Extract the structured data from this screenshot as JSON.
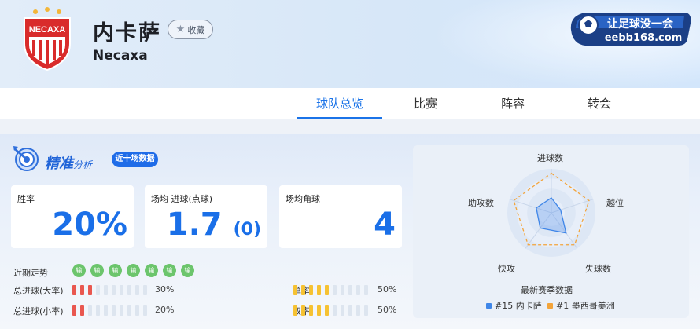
{
  "team": {
    "name_cn": "内卡萨",
    "name_en": "Necaxa",
    "crest_text": "NECAXA"
  },
  "favorite_label": "收藏",
  "site_logo": {
    "text_top": "让足球没一会",
    "text_bottom": "eebb168.com"
  },
  "tabs": [
    {
      "label": "球队总览",
      "active": true
    },
    {
      "label": "比赛",
      "active": false
    },
    {
      "label": "阵容",
      "active": false
    },
    {
      "label": "转会",
      "active": false
    }
  ],
  "analysis": {
    "title_main": "精准",
    "title_sub": "分析",
    "badge": "近十场数据",
    "cards": [
      {
        "label": "胜率",
        "value": "20%"
      },
      {
        "label": "场均 进球(点球)",
        "value": "1.7",
        "extra": "(0)"
      },
      {
        "label": "场均角球",
        "value": "4"
      }
    ],
    "recent_form": {
      "label": "近期走势",
      "results": [
        "输",
        "输",
        "输",
        "输",
        "输",
        "输",
        "输"
      ],
      "color": "#6cc56c"
    },
    "bars": [
      {
        "label": "总进球(大率)",
        "value": 30,
        "text": "30%",
        "color": "#e9574f"
      },
      {
        "label": "总进球(小率)",
        "value": 20,
        "text": "20%",
        "color": "#e9574f"
      },
      {
        "label": "单率",
        "value": 50,
        "text": "50%",
        "color": "#f6c232"
      },
      {
        "label": "双率",
        "value": 50,
        "text": "50%",
        "color": "#f6c232"
      }
    ]
  },
  "radar": {
    "axes": [
      "进球数",
      "越位",
      "失球数",
      "快攻",
      "助攻数"
    ],
    "legend_title": "最新赛季数据",
    "series": [
      {
        "name": "#15 内卡萨",
        "color": "#3f86e8",
        "values": [
          0.34,
          0.22,
          0.57,
          0.43,
          0.36
        ]
      },
      {
        "name": "#1 墨西哥美洲",
        "color": "#f3a43a",
        "values": [
          0.9,
          0.9,
          0.9,
          0.9,
          0.9
        ]
      }
    ]
  }
}
